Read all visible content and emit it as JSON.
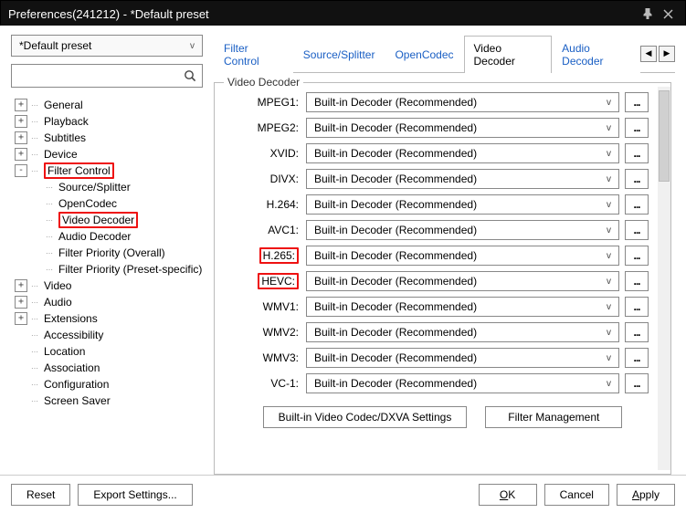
{
  "window": {
    "title": "Preferences(241212) - *Default preset"
  },
  "preset": {
    "selected": "*Default preset"
  },
  "search": {
    "value": ""
  },
  "tree": {
    "items": [
      {
        "label": "General",
        "expander": "+"
      },
      {
        "label": "Playback",
        "expander": "+"
      },
      {
        "label": "Subtitles",
        "expander": "+"
      },
      {
        "label": "Device",
        "expander": "+"
      },
      {
        "label": "Filter Control",
        "expander": "-",
        "hl": true,
        "children": [
          {
            "label": "Source/Splitter"
          },
          {
            "label": "OpenCodec"
          },
          {
            "label": "Video Decoder",
            "hl": true
          },
          {
            "label": "Audio Decoder"
          },
          {
            "label": "Filter Priority (Overall)"
          },
          {
            "label": "Filter Priority (Preset-specific)"
          }
        ]
      },
      {
        "label": "Video",
        "expander": "+"
      },
      {
        "label": "Audio",
        "expander": "+"
      },
      {
        "label": "Extensions",
        "expander": "+"
      },
      {
        "label": "Accessibility",
        "expander": ""
      },
      {
        "label": "Location",
        "expander": ""
      },
      {
        "label": "Association",
        "expander": ""
      },
      {
        "label": "Configuration",
        "expander": ""
      },
      {
        "label": "Screen Saver",
        "expander": ""
      }
    ]
  },
  "tabs": {
    "items": [
      {
        "label": "Filter Control"
      },
      {
        "label": "Source/Splitter"
      },
      {
        "label": "OpenCodec"
      },
      {
        "label": "Video Decoder",
        "active": true
      },
      {
        "label": "Audio Decoder"
      }
    ]
  },
  "fieldset": {
    "legend": "Video Decoder"
  },
  "decoders": [
    {
      "codec": "MPEG1:",
      "value": "Built-in Decoder (Recommended)"
    },
    {
      "codec": "MPEG2:",
      "value": "Built-in Decoder (Recommended)"
    },
    {
      "codec": "XVID:",
      "value": "Built-in Decoder (Recommended)"
    },
    {
      "codec": "DIVX:",
      "value": "Built-in Decoder (Recommended)"
    },
    {
      "codec": "H.264:",
      "value": "Built-in Decoder (Recommended)"
    },
    {
      "codec": "AVC1:",
      "value": "Built-in Decoder (Recommended)"
    },
    {
      "codec": "H.265:",
      "value": "Built-in Decoder (Recommended)",
      "hl": true
    },
    {
      "codec": "HEVC:",
      "value": "Built-in Decoder (Recommended)",
      "hl": true
    },
    {
      "codec": "WMV1:",
      "value": "Built-in Decoder (Recommended)"
    },
    {
      "codec": "WMV2:",
      "value": "Built-in Decoder (Recommended)"
    },
    {
      "codec": "WMV3:",
      "value": "Built-in Decoder (Recommended)"
    },
    {
      "codec": "VC-1:",
      "value": "Built-in Decoder (Recommended)"
    }
  ],
  "buttons": {
    "dxva": "Built-in Video Codec/DXVA Settings",
    "filterMgmt": "Filter Management",
    "reset": "Reset",
    "export": "Export Settings...",
    "ok": "OK",
    "cancel": "Cancel",
    "apply": "Apply"
  },
  "more": "..."
}
